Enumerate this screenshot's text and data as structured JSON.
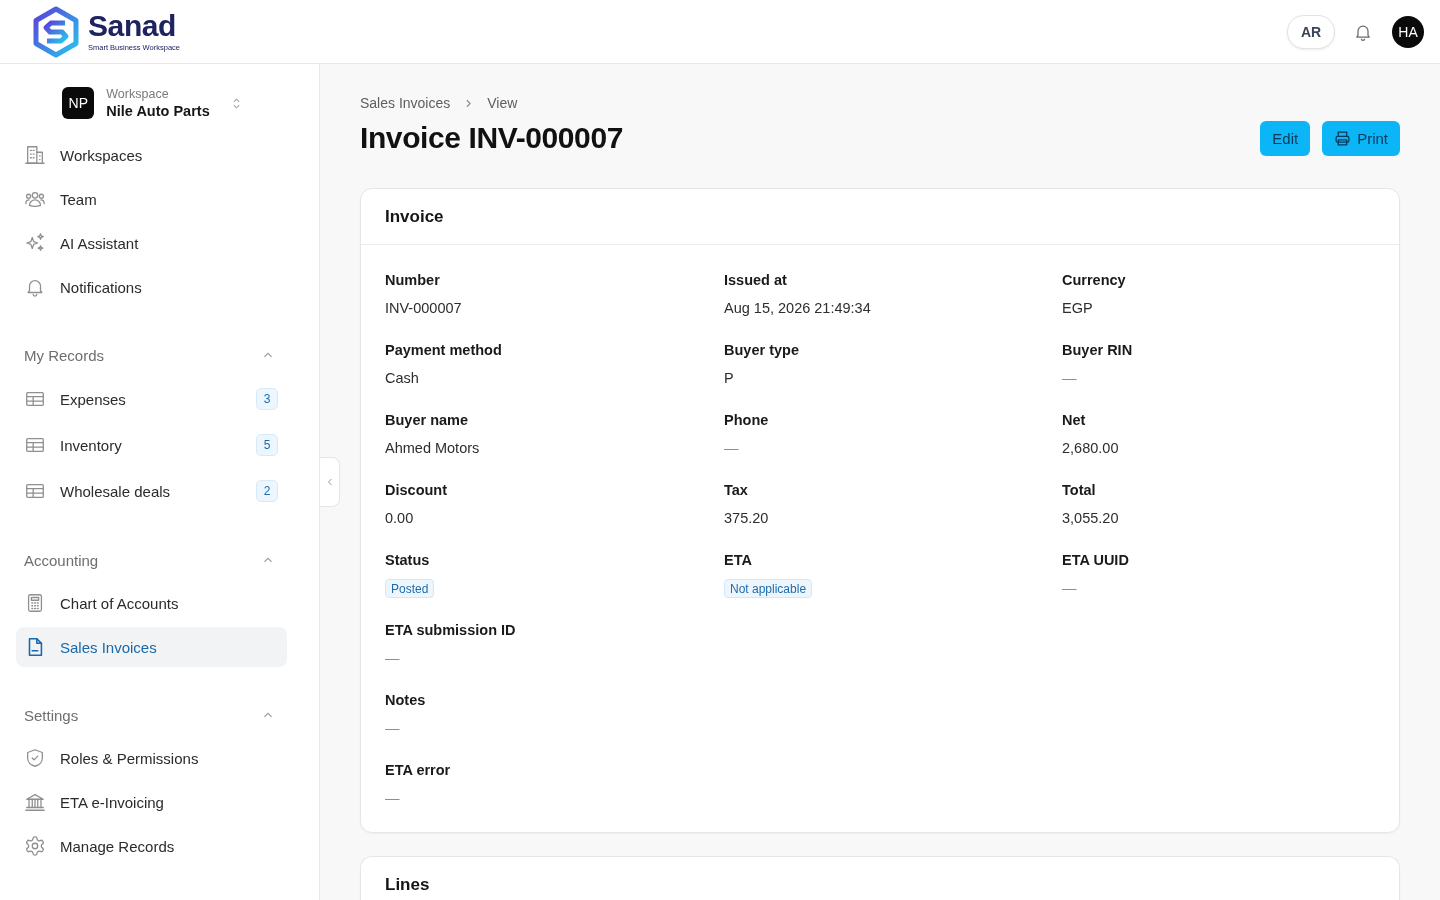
{
  "header": {
    "logo": {
      "name": "Sanad",
      "tagline": "Smart Business Workspace"
    },
    "language_button": "AR",
    "avatar": "HA"
  },
  "sidebar": {
    "workspace": {
      "initials": "NP",
      "caption": "Workspace",
      "name": "Nile Auto Parts"
    },
    "items": [
      {
        "label": "Workspaces",
        "selected": false
      },
      {
        "label": "Team",
        "selected": false
      },
      {
        "label": "AI Assistant",
        "selected": false
      },
      {
        "label": "Notifications",
        "selected": false
      }
    ],
    "sections": [
      {
        "title": "My Records",
        "expanded": true,
        "items": [
          {
            "label": "Expenses",
            "count": "3",
            "selected": false
          },
          {
            "label": "Inventory",
            "count": "5",
            "selected": false
          },
          {
            "label": "Wholesale deals",
            "count": "2",
            "selected": false
          }
        ]
      },
      {
        "title": "Accounting",
        "expanded": true,
        "items": [
          {
            "label": "Chart of Accounts",
            "selected": false
          },
          {
            "label": "Sales Invoices",
            "selected": true
          }
        ]
      },
      {
        "title": "Settings",
        "expanded": true,
        "items": [
          {
            "label": "Roles & Permissions",
            "selected": false
          },
          {
            "label": "ETA e-Invoicing",
            "selected": false
          },
          {
            "label": "Manage Records",
            "selected": false
          }
        ]
      }
    ]
  },
  "main": {
    "breadcrumb": [
      {
        "label": "Sales Invoices"
      },
      {
        "label": "View"
      }
    ],
    "title": "Invoice INV-000007",
    "actions": [
      {
        "label": "Edit",
        "kind": "plain"
      },
      {
        "label": "Print",
        "kind": "print"
      }
    ],
    "invoice_card": {
      "title": "Invoice",
      "fields": [
        {
          "label": "Number",
          "value": "INV-000007",
          "kind": "text"
        },
        {
          "label": "Issued at",
          "value": "Aug 15, 2026 21:49:34",
          "kind": "text"
        },
        {
          "label": "Currency",
          "value": "EGP",
          "kind": "text"
        },
        {
          "label": "Payment method",
          "value": "Cash",
          "kind": "text"
        },
        {
          "label": "Buyer type",
          "value": "P",
          "kind": "text"
        },
        {
          "label": "Buyer RIN",
          "value": "—",
          "kind": "empty"
        },
        {
          "label": "Buyer name",
          "value": "Ahmed Motors",
          "kind": "text"
        },
        {
          "label": "Phone",
          "value": "—",
          "kind": "empty"
        },
        {
          "label": "Net",
          "value": "2,680.00",
          "kind": "text"
        },
        {
          "label": "Discount",
          "value": "0.00",
          "kind": "text"
        },
        {
          "label": "Tax",
          "value": "375.20",
          "kind": "text"
        },
        {
          "label": "Total",
          "value": "3,055.20",
          "kind": "text"
        },
        {
          "label": "Status",
          "value": "Posted",
          "kind": "badge"
        },
        {
          "label": "ETA",
          "value": "Not applicable",
          "kind": "badge"
        },
        {
          "label": "ETA UUID",
          "value": "—",
          "kind": "empty"
        }
      ],
      "long_fields": [
        {
          "label": "ETA submission ID",
          "value": "—",
          "kind": "empty"
        },
        {
          "label": "Notes",
          "value": "—",
          "kind": "empty"
        },
        {
          "label": "ETA error",
          "value": "—",
          "kind": "empty"
        }
      ]
    },
    "lines_card": {
      "title": "Lines"
    }
  }
}
